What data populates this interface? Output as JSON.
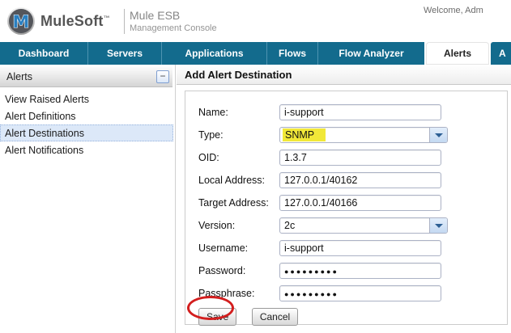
{
  "header": {
    "brand": "MuleSoft",
    "brand_tm": "™",
    "product_line1": "Mule ESB",
    "product_line2": "Management Console",
    "welcome": "Welcome, Adm"
  },
  "nav": {
    "tabs": [
      {
        "label": "Dashboard",
        "active": false
      },
      {
        "label": "Servers",
        "active": false
      },
      {
        "label": "Applications",
        "active": false
      },
      {
        "label": "Flows",
        "active": false
      },
      {
        "label": "Flow Analyzer",
        "active": false
      },
      {
        "label": "Alerts",
        "active": true
      },
      {
        "label": "A",
        "active": false,
        "partial": true
      }
    ]
  },
  "sidebar": {
    "title": "Alerts",
    "collapse_label": "−",
    "items": [
      {
        "label": "View Raised Alerts",
        "selected": false
      },
      {
        "label": "Alert Definitions",
        "selected": false
      },
      {
        "label": "Alert Destinations",
        "selected": true
      },
      {
        "label": "Alert Notifications",
        "selected": false
      }
    ]
  },
  "main": {
    "title": "Add Alert Destination",
    "form": {
      "fields": [
        {
          "label": "Name:",
          "value": "i-support",
          "control": "text"
        },
        {
          "label": "Type:",
          "value": "SNMP",
          "control": "select",
          "highlighted": true
        },
        {
          "label": "OID:",
          "value": "1.3.7",
          "control": "text"
        },
        {
          "label": "Local Address:",
          "value": "127.0.0.1/40162",
          "control": "text"
        },
        {
          "label": "Target Address:",
          "value": "127.0.0.1/40166",
          "control": "text"
        },
        {
          "label": "Version:",
          "value": "2c",
          "control": "select"
        },
        {
          "label": "Username:",
          "value": "i-support",
          "control": "text"
        },
        {
          "label": "Password:",
          "value": "●●●●●●●●●",
          "control": "password"
        },
        {
          "label": "Passphrase:",
          "value": "●●●●●●●●●",
          "control": "password"
        }
      ],
      "save_label": "Save",
      "cancel_label": "Cancel"
    }
  },
  "annotations": {
    "highlight_color": "#f1e838",
    "circle_color": "#d31e1e",
    "circled_element": "save-button"
  },
  "colors": {
    "nav_teal": "#136b8d",
    "brand_blue": "#2a7fc0",
    "selected_item_bg": "#dce8f8"
  }
}
